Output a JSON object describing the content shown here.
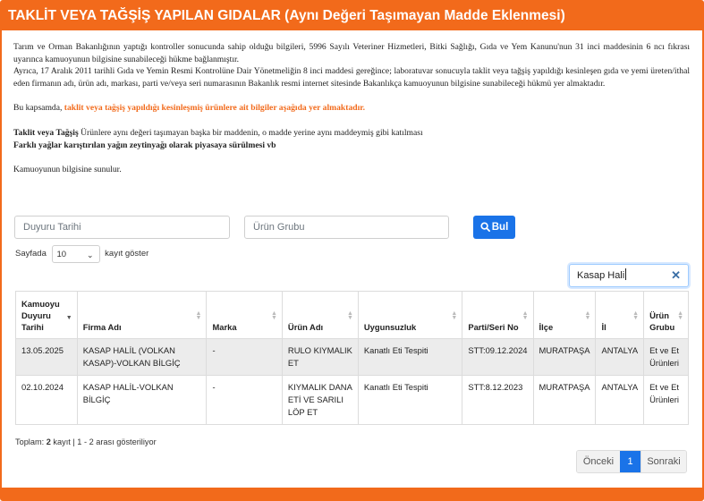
{
  "header": {
    "title": "TAKLİT VEYA TAĞŞİŞ YAPILAN GIDALAR (Aynı Değeri Taşımayan Madde Eklenmesi)"
  },
  "intro": {
    "p1": "Tarım ve Orman Bakanlığının yaptığı kontroller sonucunda sahip olduğu bilgileri, 5996 Sayılı Veteriner Hizmetleri, Bitki Sağlığı, Gıda ve Yem Kanunu'nun 31 inci maddesinin 6 ncı fıkrası uyarınca kamuoyunun bilgisine sunabileceği hükme bağlanmıştır.",
    "p2": "Ayrıca, 17 Aralık 2011 tarihli Gıda ve Yemin Resmi Kontrolüne Dair Yönetmeliğin 8 inci maddesi gereğince; laboratuvar sonucuyla taklit veya tağşiş yapıldığı kesinleşen gıda ve yemi üreten/ithal eden firmanın adı, ürün adı, markası, parti ve/veya seri numarasının Bakanlık resmi internet sitesinde Bakanlıkça kamuoyunun bilgisine sunabileceği hükmü yer almaktadır.",
    "p3_prefix": "Bu kapsamda, ",
    "p3_highlight": "taklit veya tağşiş yapıldığı kesinleşmiş ürünlere ait bilgiler aşağıda yer almaktadır.",
    "p4_bold": "Taklit veya Tağşiş",
    "p4_rest": " Ürünlere aynı değeri taşımayan başka bir maddenin, o madde yerine aynı maddeymiş gibi katılması",
    "p5": "Farklı yağlar karıştırılan yağın zeytinyağı olarak piyasaya sürülmesi vb",
    "p6": "Kamuoyunun bilgisine sunulur."
  },
  "search": {
    "date_placeholder": "Duyuru Tarihi",
    "group_placeholder": "Ürün Grubu",
    "button_label": "Bul"
  },
  "length": {
    "prefix": "Sayfada",
    "value": "10",
    "suffix": "kayıt göster"
  },
  "filter": {
    "value": "Kasap Hali"
  },
  "table": {
    "columns": [
      "Kamuoyu Duyuru Tarihi",
      "Firma Adı",
      "Marka",
      "Ürün Adı",
      "Uygunsuzluk",
      "Parti/Seri No",
      "İlçe",
      "İl",
      "Ürün Grubu"
    ],
    "rows": [
      [
        "13.05.2025",
        "KASAP HALİL (VOLKAN KASAP)-VOLKAN BİLGİÇ",
        "-",
        "RULO KIYMALIK ET",
        "Kanatlı Eti Tespiti",
        "STT:09.12.2024",
        "MURATPAŞA",
        "ANTALYA",
        "Et ve Et Ürünleri"
      ],
      [
        "02.10.2024",
        "KASAP HALİL-VOLKAN BİLGİÇ",
        "-",
        "KIYMALIK DANA ETİ VE SARILI LÖP ET",
        "Kanatlı Eti Tespiti",
        "STT:8.12.2023",
        "MURATPAŞA",
        "ANTALYA",
        "Et ve Et Ürünleri"
      ]
    ]
  },
  "info": {
    "prefix": "Toplam: ",
    "count": "2",
    "rest": " kayıt | 1 - 2 arası gösteriliyor"
  },
  "pager": {
    "prev": "Önceki",
    "current": "1",
    "next": "Sonraki"
  },
  "colors": {
    "accent": "#f26a1b",
    "primary": "#1a73e8"
  },
  "icons": {
    "search": "search-icon",
    "clear": "clear-icon",
    "sort": "sort-icon"
  }
}
